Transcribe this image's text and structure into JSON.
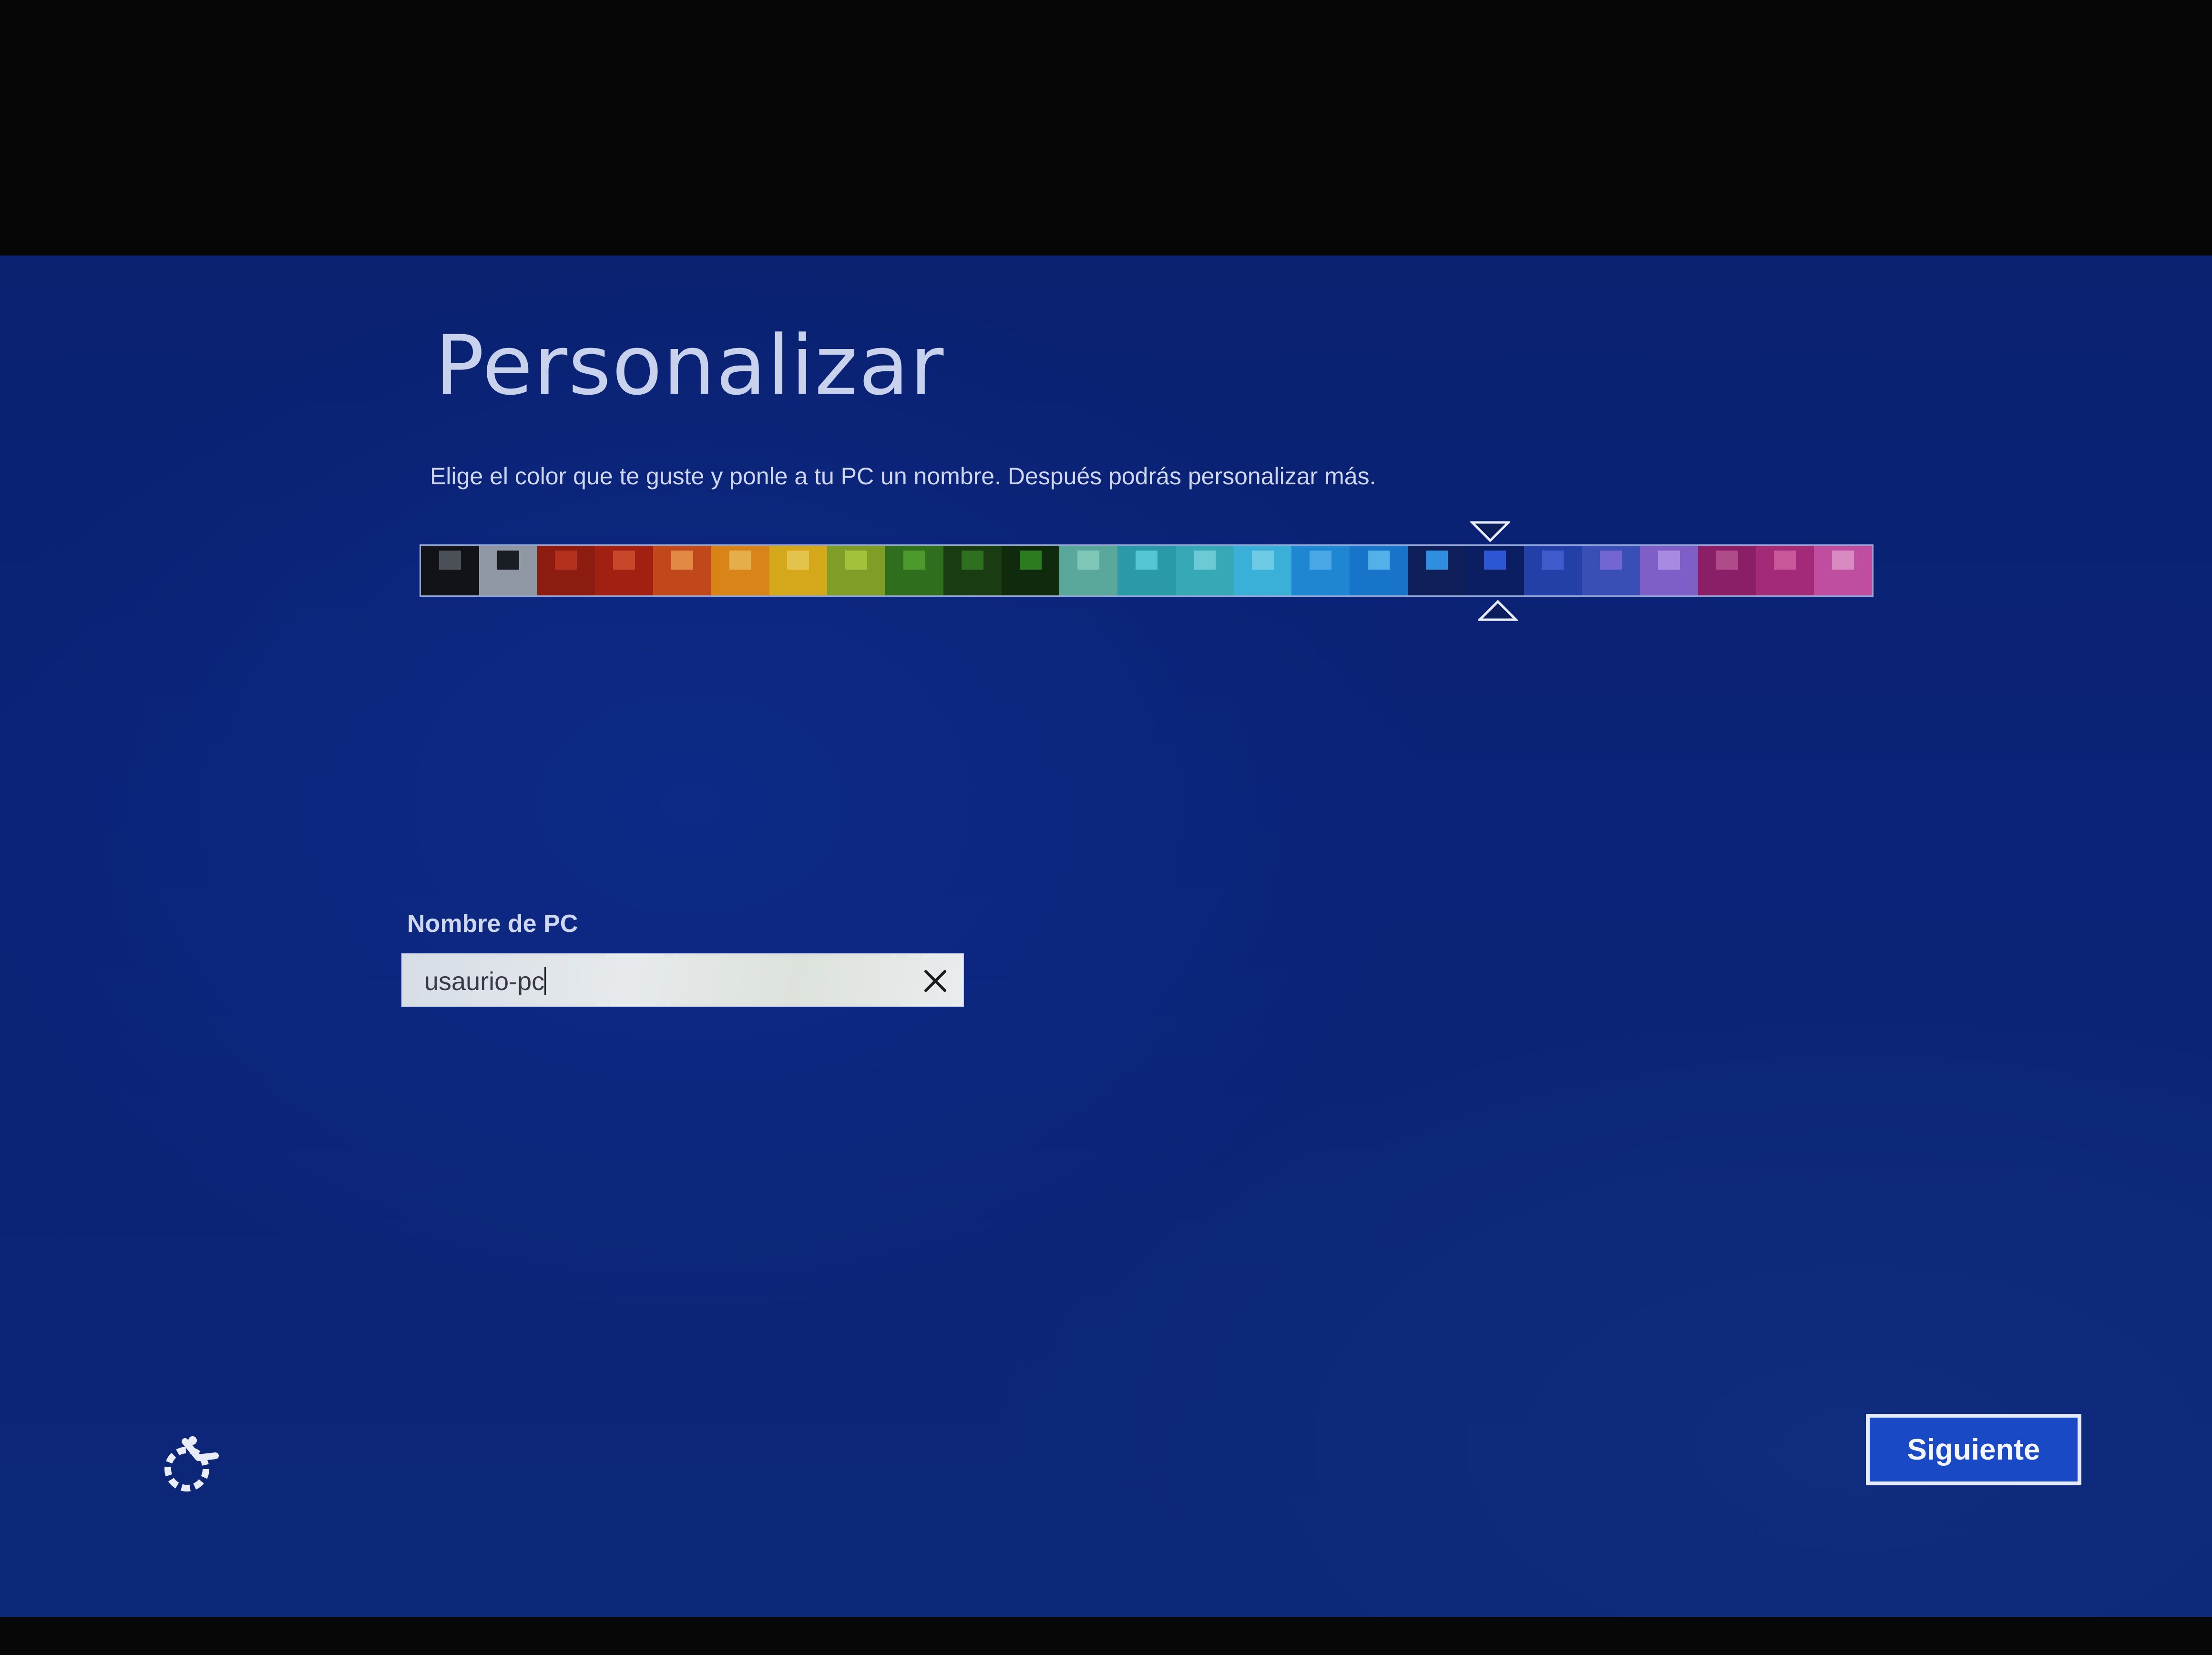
{
  "page": {
    "title": "Personalizar",
    "subtitle": "Elige el color que te guste y ponle a tu PC un nombre. Después podrás personalizar más."
  },
  "palette": {
    "selected_index": 18,
    "swatches": [
      {
        "bg": "#121318",
        "accent": "#4b4f58"
      },
      {
        "bg": "#8f96a4",
        "accent": "#1a1d24"
      },
      {
        "bg": "#8c1c10",
        "accent": "#b3301e"
      },
      {
        "bg": "#a12012",
        "accent": "#c8462a"
      },
      {
        "bg": "#c0481a",
        "accent": "#e08a46"
      },
      {
        "bg": "#d88418",
        "accent": "#e6ae4a"
      },
      {
        "bg": "#d4a81a",
        "accent": "#e3c24e"
      },
      {
        "bg": "#7f9e28",
        "accent": "#a3c23c"
      },
      {
        "bg": "#2f6e1c",
        "accent": "#4d9a2c"
      },
      {
        "bg": "#1a3c12",
        "accent": "#2f7020"
      },
      {
        "bg": "#0f2a0c",
        "accent": "#2d7b1f"
      },
      {
        "bg": "#5aa79c",
        "accent": "#7ec6b6"
      },
      {
        "bg": "#2a9aa8",
        "accent": "#55c6d4"
      },
      {
        "bg": "#37a9b6",
        "accent": "#6ccad4"
      },
      {
        "bg": "#3ab0d8",
        "accent": "#6ecbe6"
      },
      {
        "bg": "#1f86d2",
        "accent": "#4aa8e6"
      },
      {
        "bg": "#1874c9",
        "accent": "#54b0e8"
      },
      {
        "bg": "#0e1f5a",
        "accent": "#2f8ee0"
      },
      {
        "bg": "#0b1e62",
        "accent": "#2c56d4"
      },
      {
        "bg": "#2240a8",
        "accent": "#3f5ccc"
      },
      {
        "bg": "#3a4fb6",
        "accent": "#7466d2"
      },
      {
        "bg": "#7e5fc8",
        "accent": "#a88ae0"
      },
      {
        "bg": "#8a1f68",
        "accent": "#b04b8a"
      },
      {
        "bg": "#a22a78",
        "accent": "#c8589a"
      },
      {
        "bg": "#c04ea0",
        "accent": "#d98ac0"
      }
    ]
  },
  "pc_name": {
    "label": "Nombre de PC",
    "value": "usaurio-pc"
  },
  "buttons": {
    "next_label": "Siguiente"
  },
  "icons": {
    "accessibility": "ease-of-access-icon",
    "clear": "close-icon",
    "marker_top": "triangle-down-icon",
    "marker_bottom": "triangle-up-icon"
  },
  "colors": {
    "background": "#0b2378",
    "accent_button": "#1a49c6",
    "text": "#cfd7f0"
  }
}
